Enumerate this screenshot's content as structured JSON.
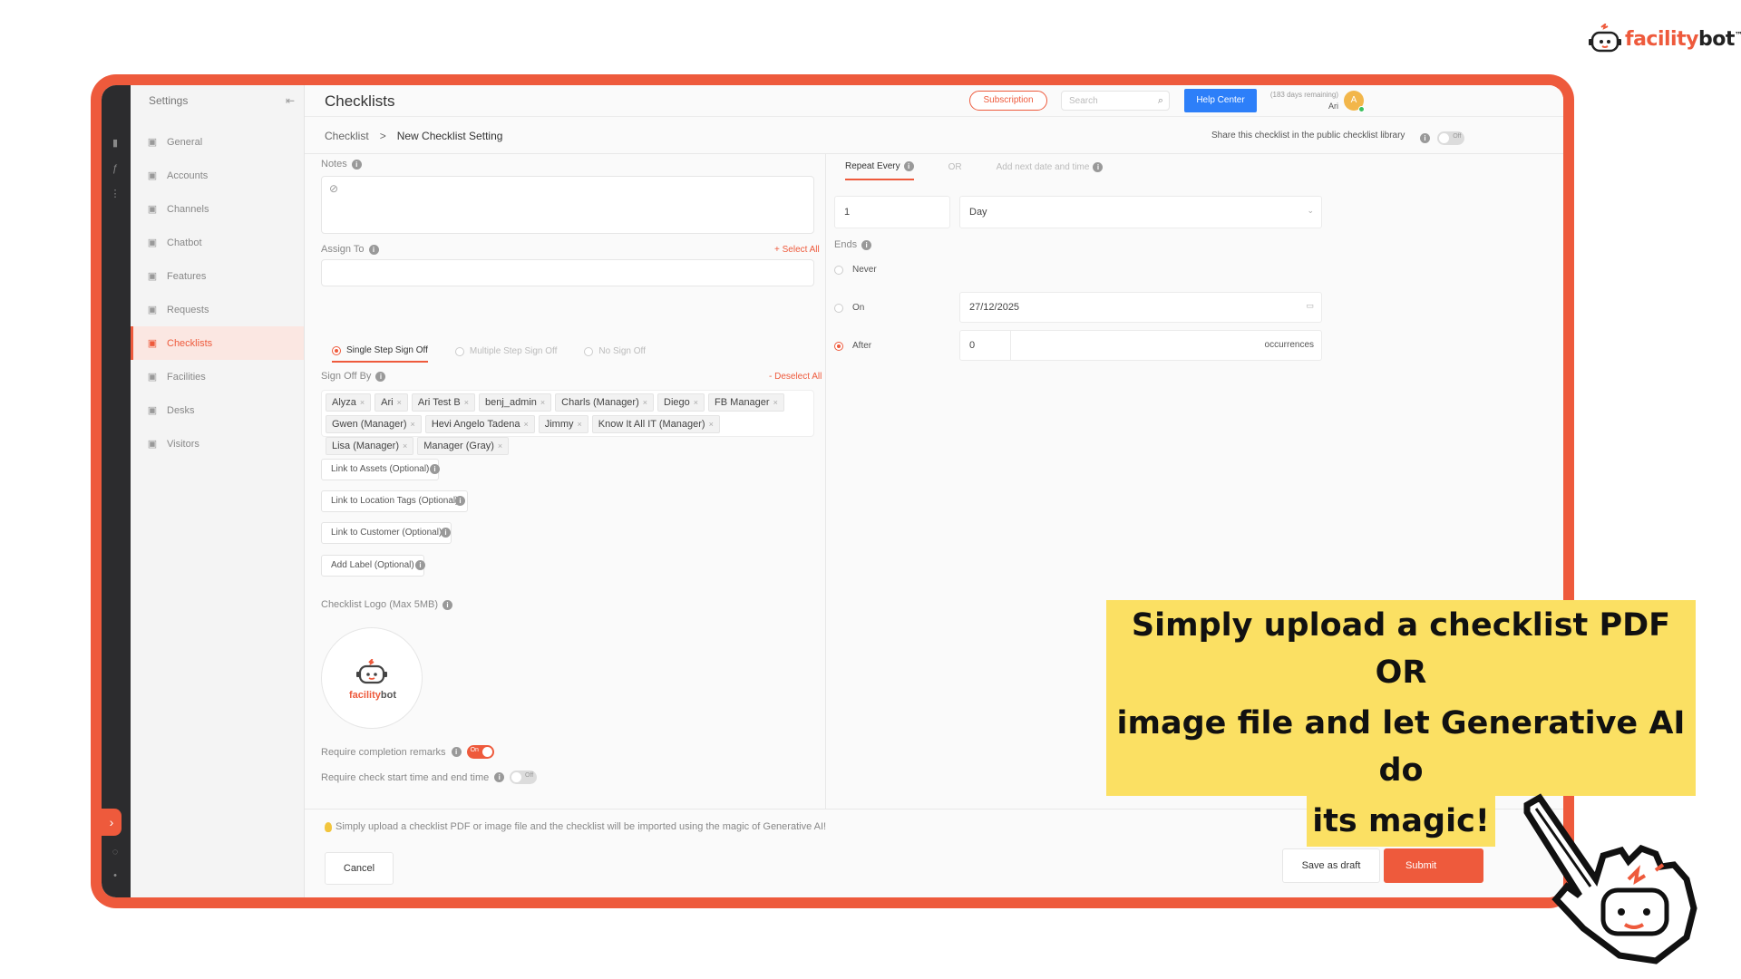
{
  "brand": {
    "text_a": "facility",
    "text_b": "bot",
    "tm": "™"
  },
  "sidebar": {
    "title": "Settings",
    "items": [
      {
        "label": "General",
        "icon": "sliders-icon"
      },
      {
        "label": "Accounts",
        "icon": "users-icon"
      },
      {
        "label": "Channels",
        "icon": "globe-icon"
      },
      {
        "label": "Chatbot",
        "icon": "chat-icon"
      },
      {
        "label": "Features",
        "icon": "rocket-icon"
      },
      {
        "label": "Requests",
        "icon": "request-icon"
      },
      {
        "label": "Checklists",
        "icon": "checklist-icon",
        "active": true
      },
      {
        "label": "Facilities",
        "icon": "calendar-icon"
      },
      {
        "label": "Desks",
        "icon": "desk-icon"
      },
      {
        "label": "Visitors",
        "icon": "visitors-icon"
      }
    ]
  },
  "header": {
    "title": "Checklists",
    "subscription": "Subscription",
    "search_placeholder": "Search",
    "help": "Help Center",
    "days_remaining": "(183 days remaining)",
    "user": "Ari",
    "avatar": "A"
  },
  "breadcrumb": {
    "root": "Checklist",
    "sep": ">",
    "current": "New Checklist Setting"
  },
  "share": {
    "label": "Share this checklist in the public checklist library",
    "toggle": "Off"
  },
  "form": {
    "notes_label": "Notes",
    "assign_label": "Assign To",
    "select_all": "+ Select All",
    "signoff_options": [
      "Single Step Sign Off",
      "Multiple Step Sign Off",
      "No Sign Off"
    ],
    "signoff_by_label": "Sign Off By",
    "deselect_all": "- Deselect All",
    "signoff_people": [
      "Alyza",
      "Ari",
      "Ari Test B",
      "benj_admin",
      "Charls (Manager)",
      "Diego",
      "FB Manager",
      "Gwen (Manager)",
      "Hevi Angelo Tadena",
      "Jimmy",
      "Know It All IT (Manager)",
      "Lisa (Manager)",
      "Manager (Gray)"
    ],
    "link_assets": "Link to Assets (Optional)",
    "link_location": "Link to Location Tags (Optional)",
    "link_customer": "Link to Customer (Optional)",
    "add_label": "Add Label (Optional)",
    "logo_label": "Checklist Logo (Max 5MB)",
    "require_remarks": "Require completion remarks",
    "require_remarks_toggle": "On",
    "require_time": "Require check start time and end time",
    "require_time_toggle": "Off",
    "hint": "Simply upload a checklist PDF or image file and the checklist will be imported using the magic of Generative AI!",
    "cancel": "Cancel",
    "save_draft": "Save as draft",
    "submit": "Submit"
  },
  "schedule": {
    "tab_repeat": "Repeat Every",
    "tab_or": "OR",
    "tab_add": "Add next date and time",
    "repeat_value": "1",
    "repeat_unit": "Day",
    "ends_label": "Ends",
    "never": "Never",
    "on": "On",
    "on_date": "27/12/2025",
    "after": "After",
    "after_value": "0",
    "occurrences": "occurrences"
  },
  "caption": {
    "line1": "Simply upload a checklist PDF OR",
    "line2": "image file and let Generative AI do",
    "line3": "its magic!"
  }
}
